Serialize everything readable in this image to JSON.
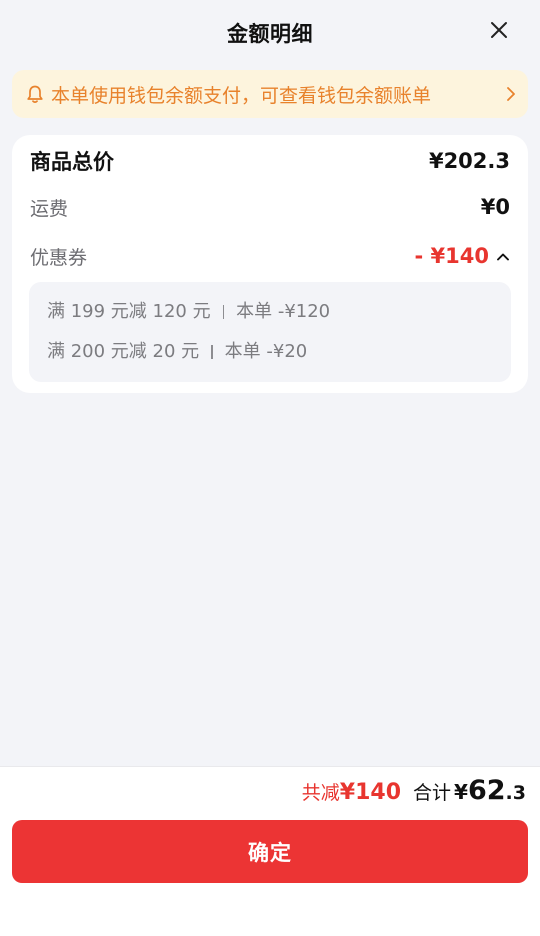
{
  "header": {
    "title": "金额明细",
    "close_icon": "close-icon"
  },
  "notice": {
    "icon": "bell-icon",
    "text": "本单使用钱包余额支付，可查看钱包余额账单",
    "arrow_icon": "chevron-right-icon",
    "color": "#e8822c",
    "background": "#fdf4dd"
  },
  "price_card": {
    "items_total_label": "商品总价",
    "items_total_value": "¥202.3",
    "shipping_label": "运费",
    "shipping_value": "¥0",
    "coupon_label": "优惠券",
    "coupon_value": "- ¥140",
    "coupon_toggle_icon": "chevron-up-icon",
    "coupons": [
      {
        "rule": "满 199 元减 120 元",
        "applied": "本单 -¥120"
      },
      {
        "rule": "满 200 元减 20 元",
        "applied": "本单 -¥20"
      }
    ]
  },
  "footer": {
    "discount_label": "共减",
    "discount_value": "¥140",
    "total_label": "合计",
    "total_symbol": "¥",
    "total_int": "62",
    "total_dec": ".3",
    "confirm_label": "确定",
    "accent_color": "#ec3434"
  }
}
